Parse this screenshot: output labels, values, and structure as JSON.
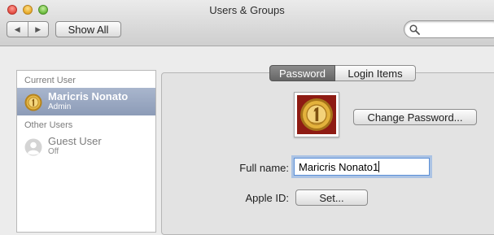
{
  "window": {
    "title": "Users & Groups"
  },
  "toolbar": {
    "back_icon": "back-arrow-icon",
    "forward_icon": "forward-arrow-icon",
    "show_all_label": "Show All",
    "search_icon": "magnifier-icon",
    "search_value": ""
  },
  "sidebar": {
    "current_user_header": "Current User",
    "current_user": {
      "name": "Maricris Nonato",
      "role": "Admin",
      "avatar": "gold-coin-icon"
    },
    "other_users_header": "Other Users",
    "other_users": [
      {
        "name": "Guest User",
        "status": "Off",
        "avatar": "silhouette-icon"
      }
    ]
  },
  "tabs": [
    {
      "label": "Password",
      "selected": true
    },
    {
      "label": "Login Items",
      "selected": false
    }
  ],
  "password_pane": {
    "user_picture": "gold-coin-icon",
    "change_password_label": "Change Password...",
    "full_name_label": "Full name:",
    "full_name_value": "Maricris Nonato1",
    "apple_id_label": "Apple ID:",
    "set_button_label": "Set..."
  },
  "colors": {
    "selection": "#8c9bb7",
    "active_tab": "#6e6e6e",
    "focus_ring": "#5b8ed6"
  }
}
